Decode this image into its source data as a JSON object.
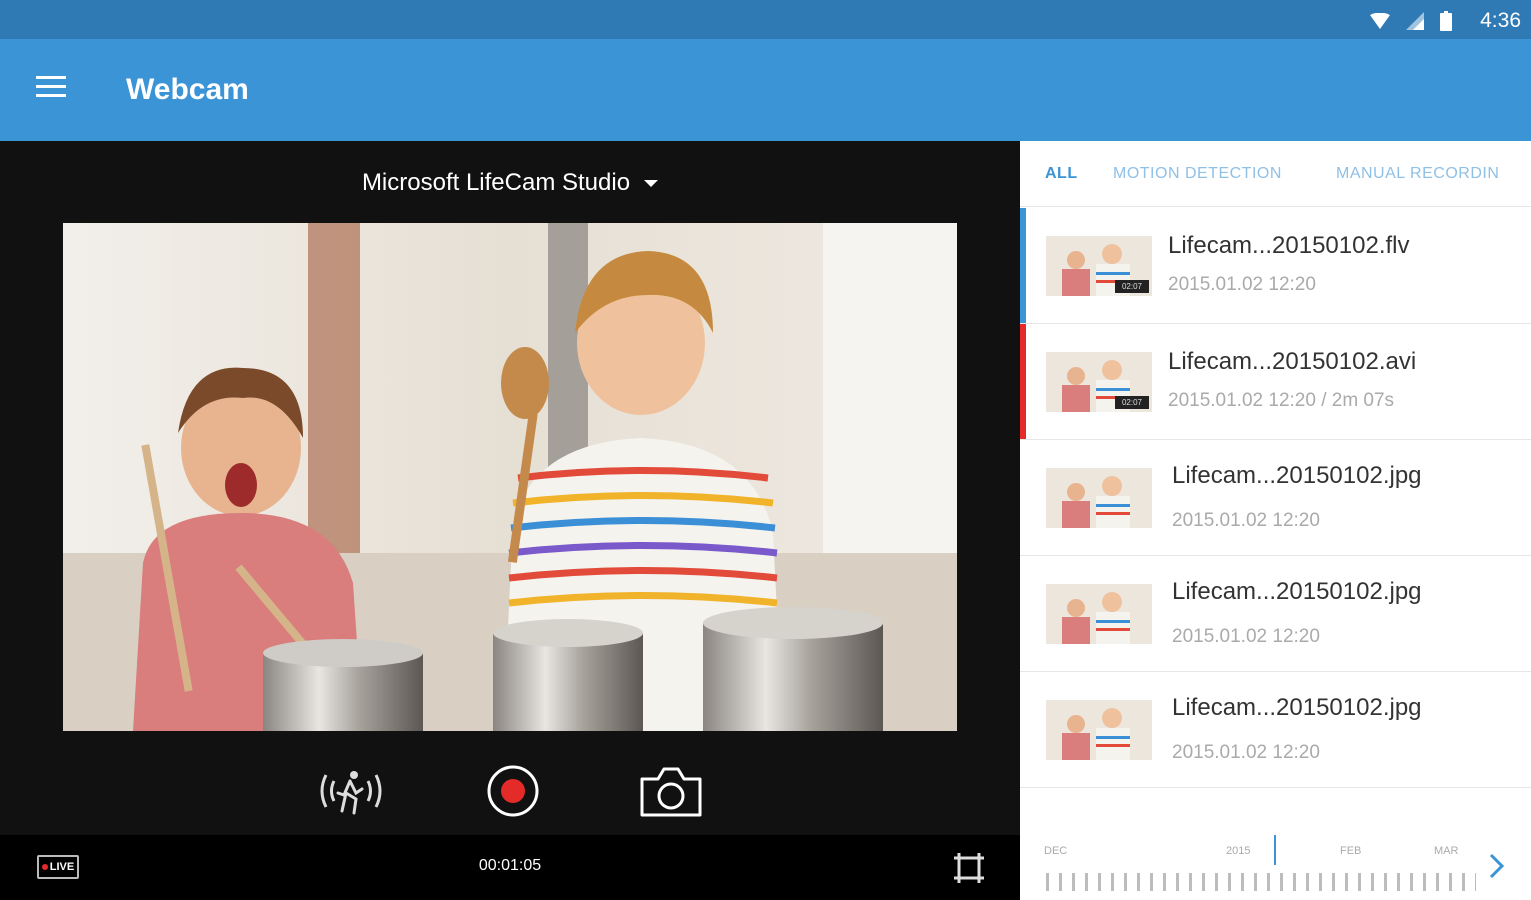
{
  "status_bar": {
    "time": "4:36",
    "icons": [
      "wifi-icon",
      "cellular-signal-icon",
      "battery-icon"
    ]
  },
  "app_bar": {
    "title": "Webcam",
    "menu_icon": "hamburger-menu-icon",
    "color": "#3b94d6"
  },
  "player": {
    "camera_name": "Microsoft LifeCam Studio",
    "live_label": "LIVE",
    "elapsed": "00:01:05",
    "controls": [
      "motion-detection-icon",
      "record-icon",
      "camera-snapshot-icon",
      "fullscreen-icon"
    ],
    "record_color": "#e52a2a"
  },
  "tabs": [
    {
      "label": "ALL",
      "active": true
    },
    {
      "label": "MOTION DETECTION",
      "active": false
    },
    {
      "label": "MANUAL RECORDIN",
      "active": false
    }
  ],
  "recordings": [
    {
      "name": "Lifecam...20150102.flv",
      "meta": "2015.01.02  12:20",
      "duration_badge": "02:07",
      "marker": "#3b94d6"
    },
    {
      "name": "Lifecam...20150102.avi",
      "meta": "2015.01.02  12:20  /  2m 07s",
      "duration_badge": "02:07",
      "marker": "#e52a2a"
    },
    {
      "name": "Lifecam...20150102.jpg",
      "meta": "2015.01.02  12:20",
      "duration_badge": "",
      "marker": ""
    },
    {
      "name": "Lifecam...20150102.jpg",
      "meta": "2015.01.02  12:20",
      "duration_badge": "",
      "marker": ""
    },
    {
      "name": "Lifecam...20150102.jpg",
      "meta": "2015.01.02  12:20",
      "duration_badge": "",
      "marker": ""
    }
  ],
  "timeline": {
    "labels": [
      "DEC",
      "2015",
      "FEB",
      "MAR"
    ],
    "next_icon": "chevron-right-icon"
  }
}
